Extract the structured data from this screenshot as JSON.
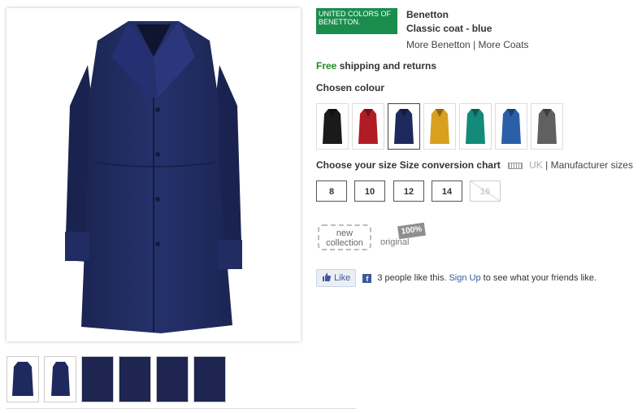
{
  "logo_text": "UNITED COLORS OF BENETTON.",
  "product": {
    "brand": "Benetton",
    "name": "Classic coat - blue",
    "more_brand": "More Benetton",
    "separator": "|",
    "more_category": "More Coats"
  },
  "shipping": {
    "free": "Free",
    "rest": "shipping and returns"
  },
  "colour": {
    "label": "Chosen colour",
    "swatches": [
      {
        "color": "#1a1a1a",
        "selected": false
      },
      {
        "color": "#b01c24",
        "selected": false
      },
      {
        "color": "#1e2a5e",
        "selected": true
      },
      {
        "color": "#d9a020",
        "selected": false
      },
      {
        "color": "#138a7a",
        "selected": false
      },
      {
        "color": "#2a5fa8",
        "selected": false
      },
      {
        "color": "#606060",
        "selected": false
      }
    ]
  },
  "size": {
    "label": "Choose your size",
    "conversion_link": "Size conversion chart",
    "uk": "UK",
    "manufacturer": "Manufacturer sizes",
    "options": [
      {
        "label": "8",
        "available": true
      },
      {
        "label": "10",
        "available": true
      },
      {
        "label": "12",
        "available": true
      },
      {
        "label": "14",
        "available": true
      },
      {
        "label": "16",
        "available": false
      }
    ]
  },
  "badges": {
    "new_line1": "new",
    "new_line2": "collection",
    "original": "original",
    "percent": "100%"
  },
  "facebook": {
    "like": "Like",
    "text_before": "3 people like this.",
    "signup": "Sign Up",
    "text_after": "to see what your friends like."
  },
  "colors": {
    "coat_blue": "#1e2a5e",
    "brand_green": "#1a8d4d",
    "fb_blue": "#3b5998"
  }
}
